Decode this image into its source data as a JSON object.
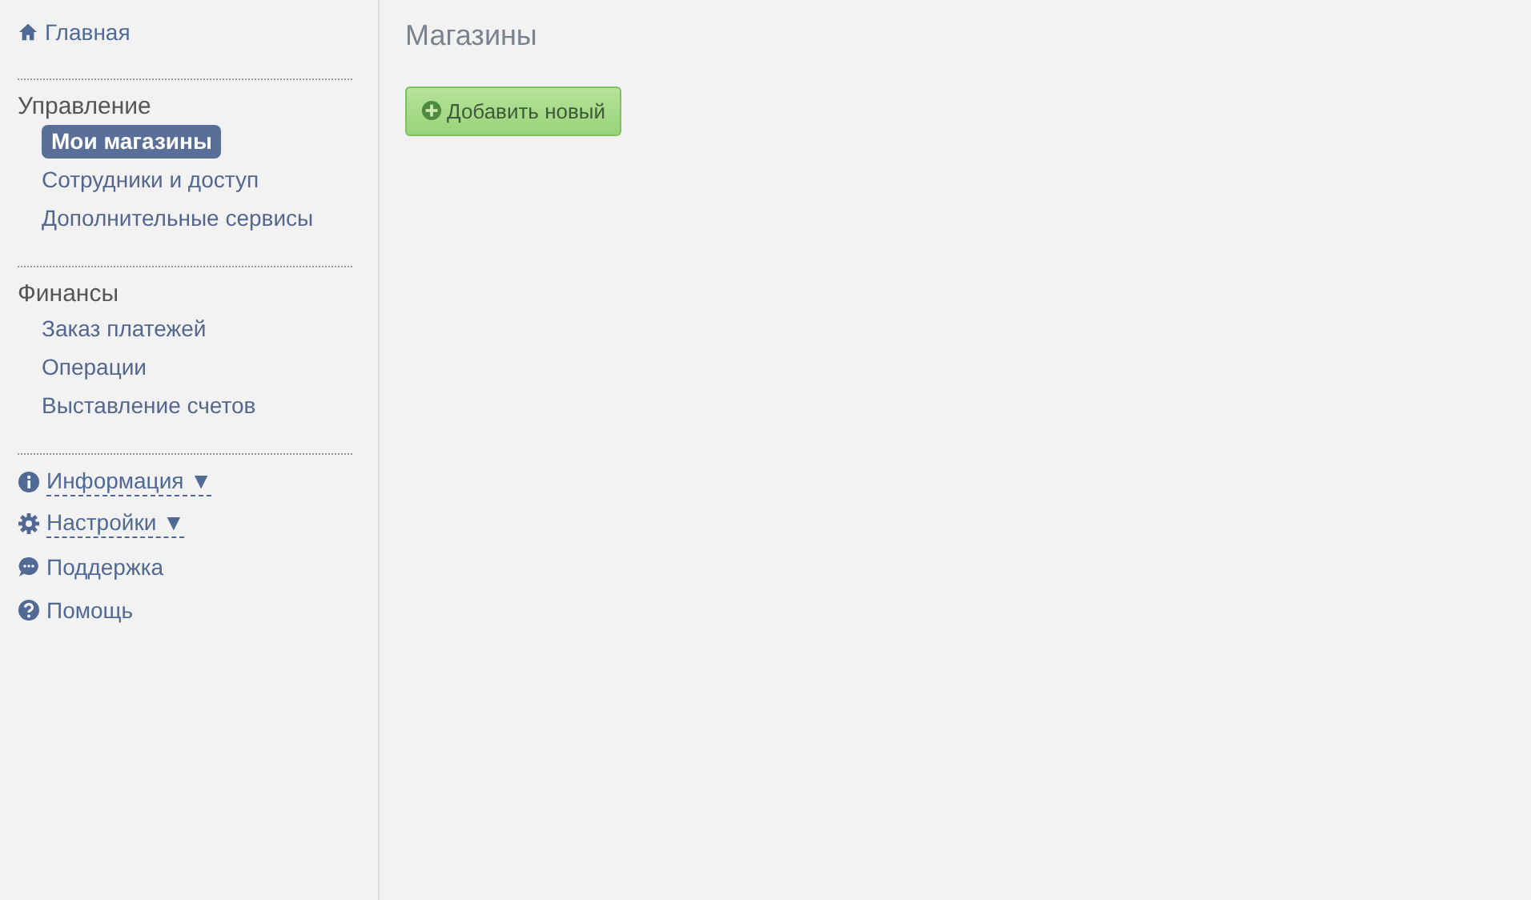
{
  "sidebar": {
    "home": {
      "label": "Главная"
    },
    "sections": [
      {
        "title": "Управление",
        "items": [
          {
            "label": "Мои магазины",
            "selected": true
          },
          {
            "label": "Сотрудники и доступ",
            "selected": false
          },
          {
            "label": "Дополнительные сервисы",
            "selected": false
          }
        ]
      },
      {
        "title": "Финансы",
        "items": [
          {
            "label": "Заказ платежей",
            "selected": false
          },
          {
            "label": "Операции",
            "selected": false
          },
          {
            "label": "Выставление счетов",
            "selected": false
          }
        ]
      }
    ],
    "links": [
      {
        "label": "Информация",
        "kind": "dropdown",
        "caret": "▼"
      },
      {
        "label": "Настройки",
        "kind": "dropdown",
        "caret": "▼"
      },
      {
        "label": "Поддержка",
        "kind": "link"
      },
      {
        "label": "Помощь",
        "kind": "link"
      }
    ]
  },
  "main": {
    "title": "Магазины",
    "add_button": "Добавить новый"
  }
}
